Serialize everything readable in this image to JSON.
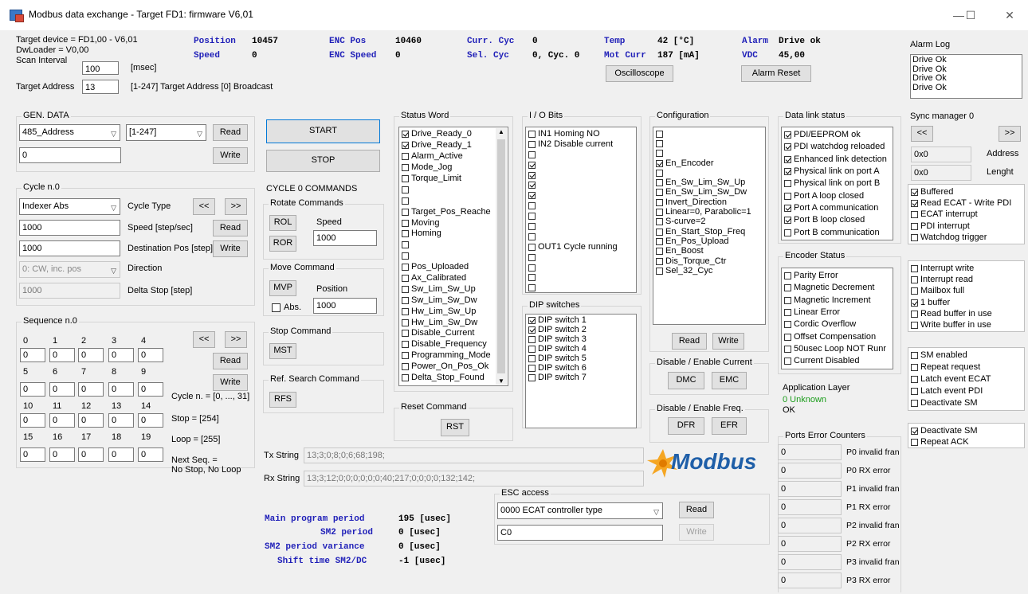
{
  "window": {
    "title": "Modbus data exchange - Target FD1: firmware V6,01",
    "min": "—",
    "max": "☐",
    "close": "✕"
  },
  "target": {
    "device": "Target device = FD1,00 - V6,01",
    "dwloader": "DwLoader = V0,00",
    "scan_label": "Scan Interval",
    "scan_value": "100",
    "scan_unit": "[msec]",
    "addr_label": "Target Address",
    "addr_value": "13",
    "addr_hint": "[1-247] Target Address [0] Broadcast"
  },
  "status": {
    "position_label": "Position",
    "position_value": "10457",
    "speed_label": "Speed",
    "speed_value": "0",
    "enc_pos_label": "ENC Pos",
    "enc_pos_value": "10460",
    "enc_speed_label": "ENC Speed",
    "enc_speed_value": "0",
    "curr_cyc_label": "Curr. Cyc",
    "curr_cyc_value": "0",
    "sel_cyc_label": "Sel. Cyc",
    "sel_cyc_value": "0, Cyc. 0",
    "temp_label": "Temp",
    "temp_value": "42 [°C]",
    "mot_curr_label": "Mot Curr",
    "mot_curr_value": "187 [mA]",
    "alarm_label": "Alarm",
    "alarm_value": "Drive ok",
    "vdc_label": "VDC",
    "vdc_value": "45,00",
    "osc_button": "Oscilloscope",
    "alarm_reset_button": "Alarm Reset"
  },
  "alarm_log": {
    "title": "Alarm Log",
    "items": [
      "Drive Ok",
      "Drive Ok",
      "Drive Ok",
      "Drive Ok"
    ]
  },
  "gen_data": {
    "title": "GEN. DATA",
    "select1": "485_Address",
    "select2": "[1-247]",
    "value": "0",
    "read": "Read",
    "write": "Write"
  },
  "cycle": {
    "title": "Cycle n.0",
    "type_select": "Indexer Abs",
    "type_label": "Cycle Type",
    "prev": "<<",
    "next": ">>",
    "speed_value": "1000",
    "speed_label": "Speed [step/sec]",
    "read": "Read",
    "dest_value": "1000",
    "dest_label": "Destination Pos [step]",
    "write": "Write",
    "dir_select": "0: CW, inc. pos",
    "dir_label": "Direction",
    "delta_value": "1000",
    "delta_label": "Delta Stop [step]"
  },
  "sequence": {
    "title": "Sequence n.0",
    "prev": "<<",
    "next": ">>",
    "read": "Read",
    "write": "Write",
    "row1_labels": [
      "0",
      "1",
      "2",
      "3",
      "4"
    ],
    "row1_values": [
      "0",
      "0",
      "0",
      "0",
      "0"
    ],
    "row2_labels": [
      "5",
      "6",
      "7",
      "8",
      "9"
    ],
    "row2_values": [
      "0",
      "0",
      "0",
      "0",
      "0"
    ],
    "row3_labels": [
      "10",
      "11",
      "12",
      "13",
      "14"
    ],
    "row3_values": [
      "0",
      "0",
      "0",
      "0",
      "0"
    ],
    "row4_labels": [
      "15",
      "16",
      "17",
      "18",
      "19"
    ],
    "row4_values": [
      "0",
      "0",
      "0",
      "0",
      "0"
    ],
    "cycle_note": "Cycle n. = [0, ..., 31]",
    "stop_note": "Stop = [254]",
    "loop_note": "Loop = [255]",
    "next_note1": "Next Seq. =",
    "next_note2": "No Stop, No Loop"
  },
  "controls": {
    "start": "START",
    "stop": "STOP",
    "cycle0": "CYCLE 0 COMMANDS",
    "rotate_title": "Rotate Commands",
    "rol": "ROL",
    "ror": "ROR",
    "speed_label": "Speed",
    "speed_value": "1000",
    "move_title": "Move Command",
    "mvp": "MVP",
    "position_label": "Position",
    "abs_label": "Abs.",
    "position_value": "1000",
    "stop_title": "Stop Command",
    "mst": "MST",
    "ref_title": "Ref. Search Command",
    "rfs": "RFS"
  },
  "strings": {
    "tx_label": "Tx String",
    "tx_value": "13;3;0;8;0;6;68;198;",
    "rx_label": "Rx String",
    "rx_value": "13;3;12;0;0;0;0;0;0;40;217;0;0;0;0;132;142;"
  },
  "timing": {
    "l1": "Main program period",
    "v1": "195 [usec]",
    "l2": "SM2 period",
    "v2": "0 [usec]",
    "l3": "SM2 period variance",
    "v3": "0 [usec]",
    "l4": "Shift time SM2/DC",
    "v4": "-1 [usec]"
  },
  "status_word": {
    "title": "Status Word",
    "items": [
      {
        "label": "Drive_Ready_0",
        "checked": true
      },
      {
        "label": "Drive_Ready_1",
        "checked": true
      },
      {
        "label": "Alarm_Active",
        "checked": false
      },
      {
        "label": "Mode_Jog",
        "checked": false
      },
      {
        "label": "Torque_Limit",
        "checked": false
      },
      {
        "label": "",
        "checked": false
      },
      {
        "label": "",
        "checked": false
      },
      {
        "label": "Target_Pos_Reache",
        "checked": false
      },
      {
        "label": "Moving",
        "checked": false
      },
      {
        "label": "Homing",
        "checked": false
      },
      {
        "label": "",
        "checked": false
      },
      {
        "label": "",
        "checked": false
      },
      {
        "label": "Pos_Uploaded",
        "checked": false
      },
      {
        "label": "Ax_Calibrated",
        "checked": false
      },
      {
        "label": "Sw_Lim_Sw_Up",
        "checked": false
      },
      {
        "label": "Sw_Lim_Sw_Dw",
        "checked": false
      },
      {
        "label": "Hw_Lim_Sw_Up",
        "checked": false
      },
      {
        "label": "Hw_Lim_Sw_Dw",
        "checked": false
      },
      {
        "label": "Disable_Current",
        "checked": false
      },
      {
        "label": "Disable_Frequency",
        "checked": false
      },
      {
        "label": "Programming_Mode",
        "checked": false
      },
      {
        "label": "Power_On_Pos_Ok",
        "checked": false
      },
      {
        "label": "Delta_Stop_Found",
        "checked": false
      }
    ]
  },
  "reset": {
    "title": "Reset Command",
    "rst": "RST"
  },
  "io_bits": {
    "title": "I / O Bits",
    "items": [
      {
        "label": "IN1 Homing NO",
        "checked": false
      },
      {
        "label": "IN2 Disable current",
        "checked": false
      },
      {
        "label": "",
        "checked": false
      },
      {
        "label": "",
        "checked": true
      },
      {
        "label": "",
        "checked": true
      },
      {
        "label": "",
        "checked": true
      },
      {
        "label": "",
        "checked": true
      },
      {
        "label": "",
        "checked": false
      },
      {
        "label": "",
        "checked": false
      },
      {
        "label": "",
        "checked": false
      },
      {
        "label": "",
        "checked": false
      },
      {
        "label": "OUT1 Cycle running",
        "checked": false
      },
      {
        "label": "",
        "checked": false
      },
      {
        "label": "",
        "checked": false
      },
      {
        "label": "",
        "checked": false
      },
      {
        "label": "",
        "checked": false
      }
    ]
  },
  "dip": {
    "title": "DIP switches",
    "items": [
      {
        "label": "DIP switch 1",
        "checked": true
      },
      {
        "label": "DIP switch 2",
        "checked": true
      },
      {
        "label": "DIP switch 3",
        "checked": false
      },
      {
        "label": "DIP switch 4",
        "checked": false
      },
      {
        "label": "DIP switch 5",
        "checked": false
      },
      {
        "label": "DIP switch 6",
        "checked": false
      },
      {
        "label": "DIP switch 7",
        "checked": false
      }
    ]
  },
  "config": {
    "title": "Configuration",
    "read": "Read",
    "write": "Write",
    "items": [
      {
        "label": "",
        "checked": false
      },
      {
        "label": "",
        "checked": false
      },
      {
        "label": "",
        "checked": false
      },
      {
        "label": "En_Encoder",
        "checked": true
      },
      {
        "label": "",
        "checked": false
      },
      {
        "label": "En_Sw_Lim_Sw_Up",
        "checked": false
      },
      {
        "label": "En_Sw_Lim_Sw_Dw",
        "checked": false
      },
      {
        "label": "Invert_Direction",
        "checked": false
      },
      {
        "label": "Linear=0, Parabolic=1",
        "checked": false
      },
      {
        "label": "S-curve=2",
        "checked": false
      },
      {
        "label": "En_Start_Stop_Freq",
        "checked": false
      },
      {
        "label": "En_Pos_Upload",
        "checked": false
      },
      {
        "label": "En_Boost",
        "checked": false
      },
      {
        "label": "Dis_Torque_Ctr",
        "checked": false
      },
      {
        "label": "Sel_32_Cyc",
        "checked": false
      }
    ]
  },
  "current": {
    "title": "Disable / Enable Current",
    "dmc": "DMC",
    "emc": "EMC"
  },
  "freq": {
    "title": "Disable / Enable Freq.",
    "dfr": "DFR",
    "efr": "EFR"
  },
  "logo": {
    "text": "Modbus"
  },
  "esc": {
    "title": "ESC access",
    "select": "0000 ECAT controller type",
    "value": "C0",
    "read": "Read",
    "write": "Write"
  },
  "data_link": {
    "title": "Data link status",
    "items": [
      {
        "label": "PDI/EEPROM ok",
        "checked": true
      },
      {
        "label": "PDI watchdog reloaded",
        "checked": true
      },
      {
        "label": "Enhanced link detection",
        "checked": true
      },
      {
        "label": "Physical link on port A",
        "checked": true
      },
      {
        "label": "Physical link on port B",
        "checked": false
      },
      {
        "label": "Port A loop closed",
        "checked": false
      },
      {
        "label": "Port A communication",
        "checked": true
      },
      {
        "label": "Port B loop closed",
        "checked": true
      },
      {
        "label": "Port B communication",
        "checked": false
      }
    ]
  },
  "encoder": {
    "title": "Encoder Status",
    "items": [
      {
        "label": "Parity Error",
        "checked": false
      },
      {
        "label": "Magnetic Decrement",
        "checked": false
      },
      {
        "label": "Magnetic Increment",
        "checked": false
      },
      {
        "label": "Linear Error",
        "checked": false
      },
      {
        "label": "Cordic Overflow",
        "checked": false
      },
      {
        "label": "Offset Compensation",
        "checked": false
      },
      {
        "label": "50usec Loop NOT Runr",
        "checked": false
      },
      {
        "label": "Current Disabled",
        "checked": false
      }
    ]
  },
  "app_layer": {
    "title": "Application Layer",
    "state": "0 Unknown",
    "status": "OK"
  },
  "ports": {
    "title": "Ports Error Counters",
    "rows": [
      {
        "value": "0",
        "label": "P0 invalid fran"
      },
      {
        "value": "0",
        "label": "P0 RX error"
      },
      {
        "value": "0",
        "label": "P1 invalid fran"
      },
      {
        "value": "0",
        "label": "P1 RX error"
      },
      {
        "value": "0",
        "label": "P2 invalid fran"
      },
      {
        "value": "0",
        "label": "P2 RX error"
      },
      {
        "value": "0",
        "label": "P3 invalid fran"
      },
      {
        "value": "0",
        "label": "P3 RX error"
      }
    ]
  },
  "sync": {
    "title": "Sync manager 0",
    "prev": "<<",
    "next": ">>",
    "addr_value": "0x0",
    "addr_label": "Address",
    "len_value": "0x0",
    "len_label": "Lenght",
    "group1": [
      {
        "label": "Buffered",
        "checked": true
      },
      {
        "label": "Read ECAT - Write PDI",
        "checked": true
      },
      {
        "label": "ECAT interrupt",
        "checked": false
      },
      {
        "label": "PDI interrupt",
        "checked": false
      },
      {
        "label": "Watchdog trigger",
        "checked": false
      }
    ],
    "group2": [
      {
        "label": "Interrupt write",
        "checked": false
      },
      {
        "label": "Interrupt read",
        "checked": false
      },
      {
        "label": "Mailbox full",
        "checked": false
      },
      {
        "label": "1 buffer",
        "checked": true
      },
      {
        "label": "Read buffer in use",
        "checked": false
      },
      {
        "label": "Write buffer in use",
        "checked": false
      }
    ],
    "group3": [
      {
        "label": "SM enabled",
        "checked": false
      },
      {
        "label": "Repeat request",
        "checked": false
      },
      {
        "label": "Latch event ECAT",
        "checked": false
      },
      {
        "label": "Latch event PDI",
        "checked": false
      },
      {
        "label": "Deactivate SM",
        "checked": false
      }
    ],
    "group4": [
      {
        "label": "Deactivate SM",
        "checked": true
      },
      {
        "label": "Repeat ACK",
        "checked": false
      }
    ]
  }
}
